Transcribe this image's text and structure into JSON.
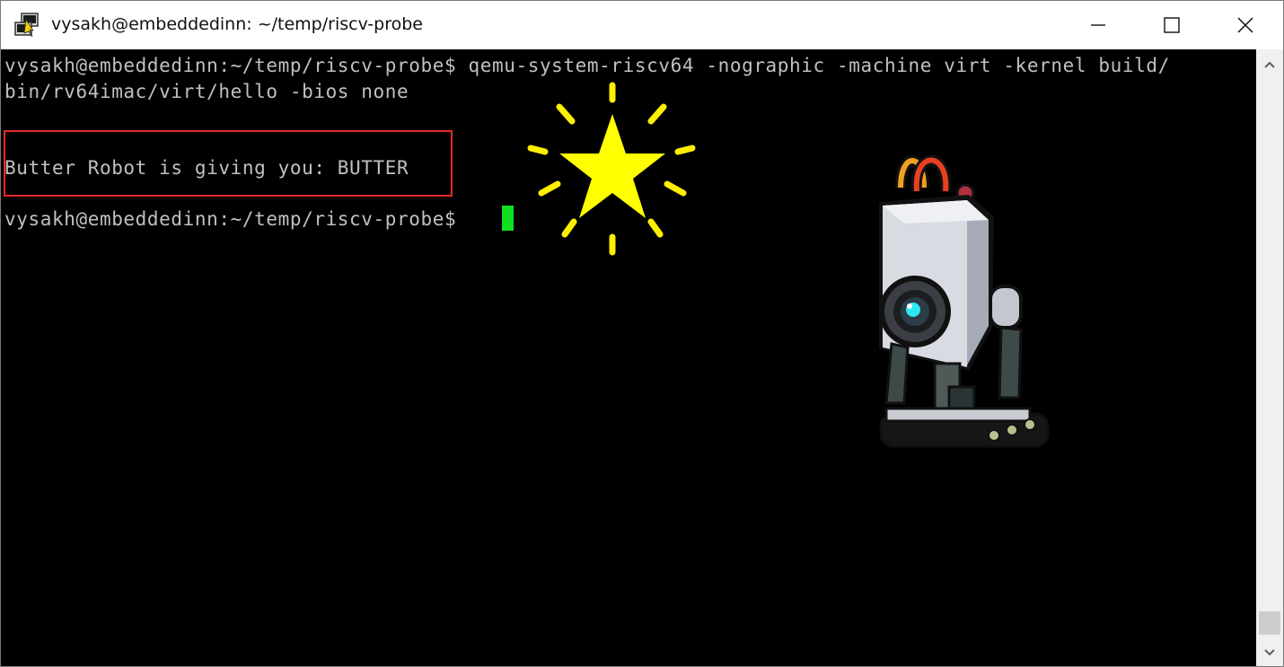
{
  "window": {
    "title": "vysakh@embeddedinn: ~/temp/riscv-probe",
    "app_icon": "putty-icon"
  },
  "caption_buttons": {
    "minimize_icon": "minimize-icon",
    "maximize_icon": "maximize-icon",
    "close_icon": "close-icon"
  },
  "terminal": {
    "lines": [
      "vysakh@embeddedinn:~/temp/riscv-probe$ qemu-system-riscv64 -nographic -machine virt -kernel build/",
      "bin/rv64imac/virt/hello -bios none",
      "Butter Robot is giving you: BUTTER",
      "vysakh@embeddedinn:~/temp/riscv-probe$ "
    ],
    "cursor_color": "#10e020",
    "highlight_color": "#e52a2a",
    "text_color": "#c0c0c0",
    "background": "#000000"
  },
  "decorations": {
    "star": "sparkle-star-icon",
    "robot": "butter-robot-illustration"
  },
  "scrollbar": {
    "up_icon": "chevron-up-icon",
    "down_icon": "chevron-down-icon"
  }
}
